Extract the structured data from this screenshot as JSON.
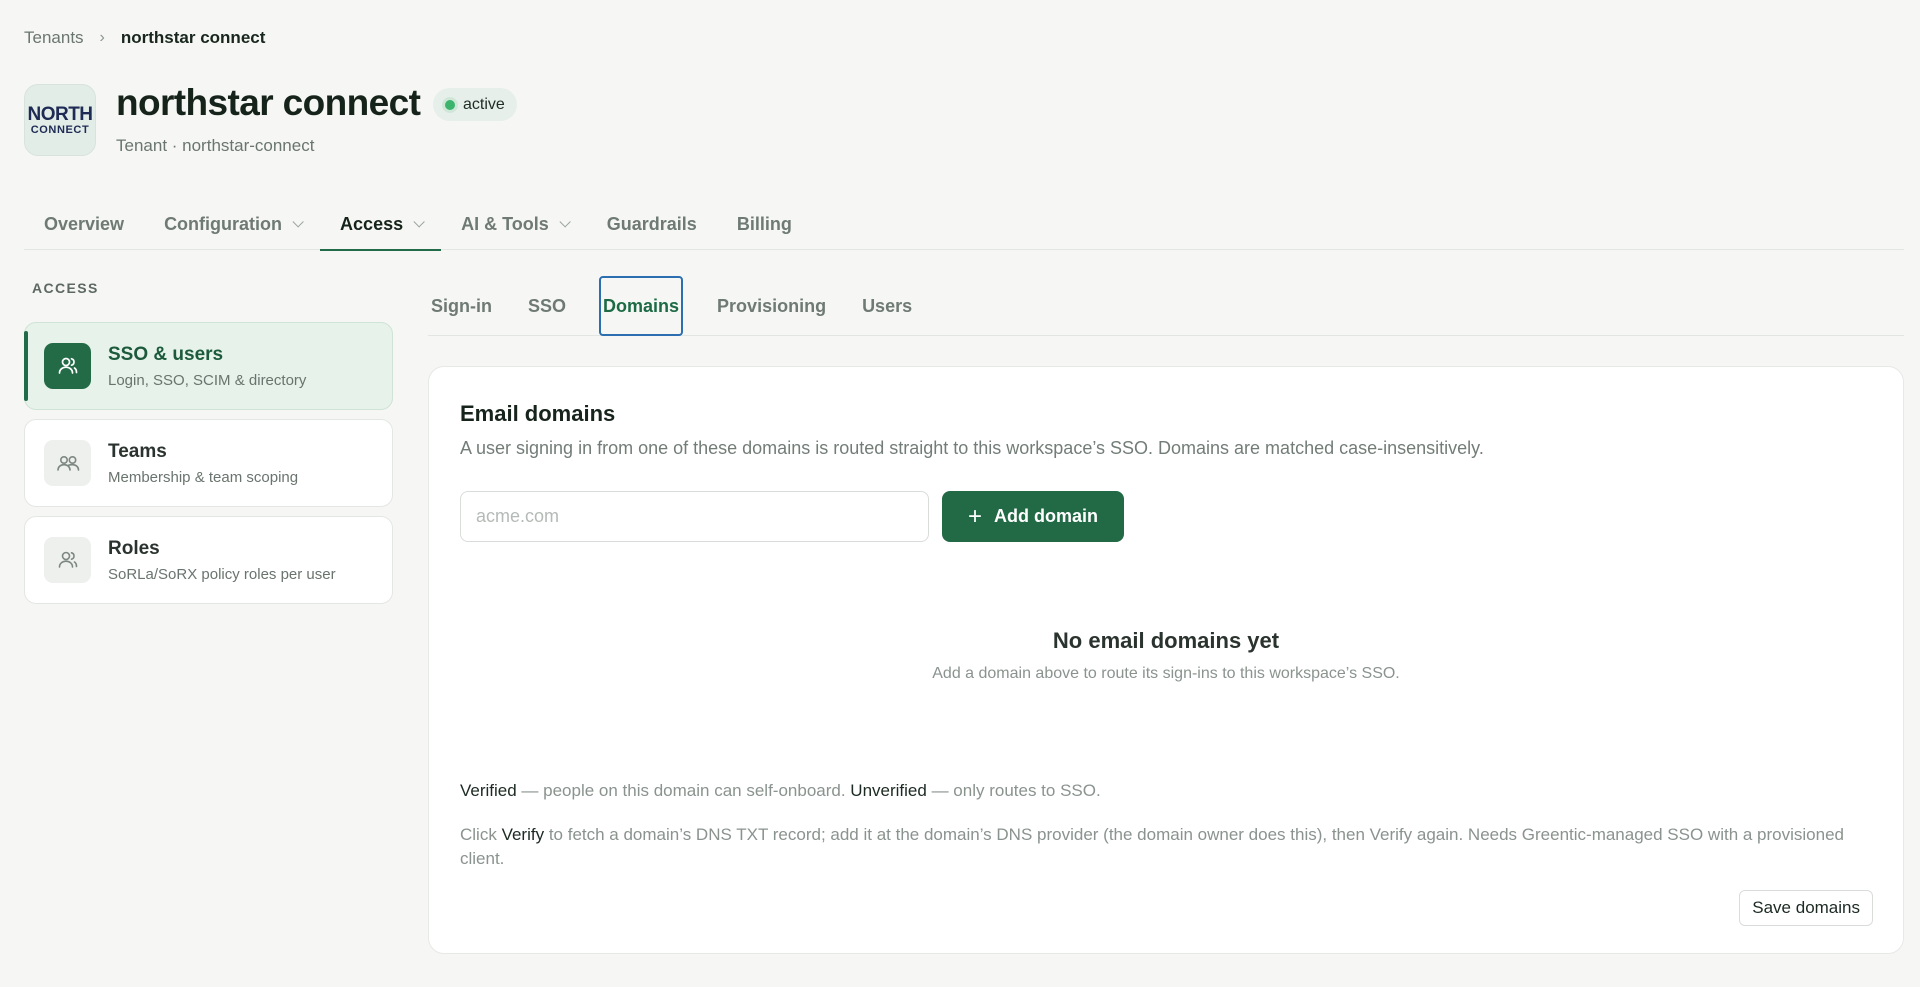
{
  "breadcrumb": {
    "parent": "Tenants",
    "separator": "›",
    "current": "northstar connect"
  },
  "header": {
    "logo_line1": "NORTH",
    "logo_line2": "CONNECT",
    "title": "northstar connect",
    "status": "active",
    "subtitle": "Tenant · northstar-connect"
  },
  "main_tabs": [
    {
      "label": "Overview",
      "dropdown": false
    },
    {
      "label": "Configuration",
      "dropdown": true
    },
    {
      "label": "Access",
      "dropdown": true,
      "active": true
    },
    {
      "label": "AI & Tools",
      "dropdown": true
    },
    {
      "label": "Guardrails",
      "dropdown": false
    },
    {
      "label": "Billing",
      "dropdown": false
    }
  ],
  "sidebar": {
    "heading": "ACCESS",
    "items": [
      {
        "title": "SSO & users",
        "desc": "Login, SSO, SCIM & directory",
        "icon": "users-icon",
        "active": true
      },
      {
        "title": "Teams",
        "desc": "Membership & team scoping",
        "icon": "team-icon",
        "active": false
      },
      {
        "title": "Roles",
        "desc": "SoRLa/SoRX policy roles per user",
        "icon": "user-role-icon",
        "active": false
      }
    ]
  },
  "sub_tabs": [
    {
      "label": "Sign-in"
    },
    {
      "label": "SSO"
    },
    {
      "label": "Domains",
      "active": true
    },
    {
      "label": "Provisioning"
    },
    {
      "label": "Users"
    }
  ],
  "panel": {
    "title": "Email domains",
    "description": "A user signing in from one of these domains is routed straight to this workspace’s SSO. Domains are matched case-insensitively.",
    "input_placeholder": "acme.com",
    "input_value": "",
    "add_button": "Add domain",
    "empty_title": "No email domains yet",
    "empty_desc": "Add a domain above to route its sign-ins to this workspace’s SSO.",
    "legend": {
      "verified": "Verified",
      "verified_text": " — people on this domain can self-onboard. ",
      "unverified": "Unverified",
      "unverified_text": " — only routes to SSO."
    },
    "help": {
      "pre": "Click ",
      "verify": "Verify",
      "post": " to fetch a domain’s DNS TXT record; add it at the domain’s DNS provider (the domain owner does this), then Verify again. Needs Greentic-managed SSO with a provisioned client."
    },
    "save_button": "Save domains"
  },
  "colors": {
    "accent": "#226b48",
    "status_dot": "#3cb46e",
    "focus_ring": "#2c6fb0",
    "background": "#f6f7f4"
  }
}
